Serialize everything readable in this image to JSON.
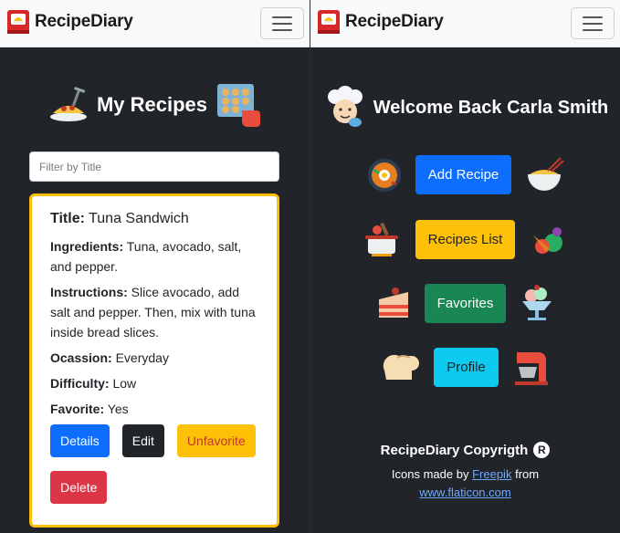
{
  "app": {
    "brand": "RecipeDiary"
  },
  "left": {
    "page_title": "My Recipes",
    "filter_placeholder": "Filter by Title",
    "recipe": {
      "title_label": "Title:",
      "title_value": "Tuna Sandwich",
      "ingredients_label": "Ingredients:",
      "ingredients_value": "Tuna, avocado, salt, and pepper.",
      "instructions_label": "Instructions:",
      "instructions_value": "Slice avocado, add salt and pepper. Then, mix with tuna inside bread slices.",
      "occasion_label": "Ocassion:",
      "occasion_value": "Everyday",
      "difficulty_label": "Difficulty:",
      "difficulty_value": "Low",
      "favorite_label": "Favorite:",
      "favorite_value": "Yes"
    },
    "buttons": {
      "details": "Details",
      "edit": "Edit",
      "unfavorite": "Unfavorite",
      "delete": "Delete"
    }
  },
  "right": {
    "welcome": "Welcome Back Carla Smith",
    "menu": {
      "add_recipe": "Add Recipe",
      "recipes_list": "Recipes List",
      "favorites": "Favorites",
      "profile": "Profile"
    },
    "footer": {
      "copyright": "RecipeDiary Copyrigth",
      "reg_symbol": "R",
      "credit_prefix": "Icons made by",
      "credit_author": "Freepik",
      "credit_mid": "from",
      "credit_site": "www.flaticon.com"
    }
  },
  "colors": {
    "background": "#212529",
    "primary": "#0d6efd",
    "warning": "#ffc107",
    "success": "#198754",
    "danger": "#dc3545",
    "info": "#0dcaf0"
  },
  "icons": {
    "brand": "recipe-book-icon",
    "title_left": "spaghetti-icon",
    "title_right": "cookie-tray-icon",
    "welcome": "chef-icon",
    "add_left": "bibimbap-icon",
    "add_right": "noodle-bowl-icon",
    "list_left": "cooking-pot-icon",
    "list_right": "vegetables-icon",
    "fav_left": "cake-slice-icon",
    "fav_right": "ice-cream-sundae-icon",
    "profile_left": "bread-icon",
    "profile_right": "stand-mixer-icon"
  }
}
